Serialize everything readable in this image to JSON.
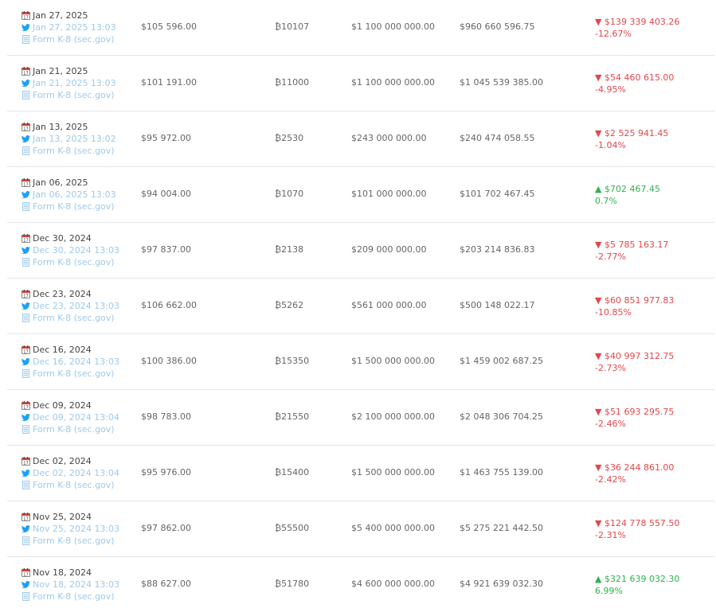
{
  "labels": {
    "filing": "Form K-8 (sec.gov)"
  },
  "colors": {
    "negative": "#e2474b",
    "positive": "#2fb24c",
    "link": "#9ec9ea"
  },
  "icons": {
    "date": "calendar-icon",
    "tweet": "twitter-icon",
    "filing": "document-icon"
  },
  "rows": [
    {
      "date": "Jan 27, 2025",
      "tweet": "Jan 27, 2025 13:03",
      "filing": "Form K-8 (sec.gov)",
      "price": "$105 596.00",
      "btc": "₿10107",
      "cost": "$1 100 000 000.00",
      "value": "$960 660 596.75",
      "change_amount": "▼ $139 339 403.26",
      "change_pct": "-12.67%",
      "direction": "down"
    },
    {
      "date": "Jan 21, 2025",
      "tweet": "Jan 21, 2025 13:03",
      "filing": "Form K-8 (sec.gov)",
      "price": "$101 191.00",
      "btc": "₿11000",
      "cost": "$1 100 000 000.00",
      "value": "$1 045 539 385.00",
      "change_amount": "▼ $54 460 615.00",
      "change_pct": "-4.95%",
      "direction": "down"
    },
    {
      "date": "Jan 13, 2025",
      "tweet": "Jan 13, 2025 13:02",
      "filing": "Form K-8 (sec.gov)",
      "price": "$95 972.00",
      "btc": "₿2530",
      "cost": "$243 000 000.00",
      "value": "$240 474 058.55",
      "change_amount": "▼ $2 525 941.45",
      "change_pct": "-1.04%",
      "direction": "down"
    },
    {
      "date": "Jan 06, 2025",
      "tweet": "Jan 06, 2025 13:03",
      "filing": "Form K-8 (sec.gov)",
      "price": "$94 004.00",
      "btc": "₿1070",
      "cost": "$101 000 000.00",
      "value": "$101 702 467.45",
      "change_amount": "▲ $702 467.45",
      "change_pct": "0.7%",
      "direction": "up"
    },
    {
      "date": "Dec 30, 2024",
      "tweet": "Dec 30, 2024 13:03",
      "filing": "Form K-8 (sec.gov)",
      "price": "$97 837.00",
      "btc": "₿2138",
      "cost": "$209 000 000.00",
      "value": "$203 214 836.83",
      "change_amount": "▼ $5 785 163.17",
      "change_pct": "-2.77%",
      "direction": "down"
    },
    {
      "date": "Dec 23, 2024",
      "tweet": "Dec 23, 2024 13:03",
      "filing": "Form K-8 (sec.gov)",
      "price": "$106 662.00",
      "btc": "₿5262",
      "cost": "$561 000 000.00",
      "value": "$500 148 022.17",
      "change_amount": "▼ $60 851 977.83",
      "change_pct": "-10.85%",
      "direction": "down"
    },
    {
      "date": "Dec 16, 2024",
      "tweet": "Dec 16, 2024 13:03",
      "filing": "Form K-8 (sec.gov)",
      "price": "$100 386.00",
      "btc": "₿15350",
      "cost": "$1 500 000 000.00",
      "value": "$1 459 002 687.25",
      "change_amount": "▼ $40 997 312.75",
      "change_pct": "-2.73%",
      "direction": "down"
    },
    {
      "date": "Dec 09, 2024",
      "tweet": "Dec 09, 2024 13:04",
      "filing": "Form K-8 (sec.gov)",
      "price": "$98 783.00",
      "btc": "₿21550",
      "cost": "$2 100 000 000.00",
      "value": "$2 048 306 704.25",
      "change_amount": "▼ $51 693 295.75",
      "change_pct": "-2.46%",
      "direction": "down"
    },
    {
      "date": "Dec 02, 2024",
      "tweet": "Dec 02, 2024 13:04",
      "filing": "Form K-8 (sec.gov)",
      "price": "$95 976.00",
      "btc": "₿15400",
      "cost": "$1 500 000 000.00",
      "value": "$1 463 755 139.00",
      "change_amount": "▼ $36 244 861.00",
      "change_pct": "-2.42%",
      "direction": "down"
    },
    {
      "date": "Nov 25, 2024",
      "tweet": "Nov 25, 2024 13:03",
      "filing": "Form K-8 (sec.gov)",
      "price": "$97 862.00",
      "btc": "₿55500",
      "cost": "$5 400 000 000.00",
      "value": "$5 275 221 442.50",
      "change_amount": "▼ $124 778 557.50",
      "change_pct": "-2.31%",
      "direction": "down"
    },
    {
      "date": "Nov 18, 2024",
      "tweet": "Nov 18, 2024 13:03",
      "filing": "Form K-8 (sec.gov)",
      "price": "$88 627.00",
      "btc": "₿51780",
      "cost": "$4 600 000 000.00",
      "value": "$4 921 639 032.30",
      "change_amount": "▲ $321 639 032.30",
      "change_pct": "6.99%",
      "direction": "up"
    }
  ]
}
